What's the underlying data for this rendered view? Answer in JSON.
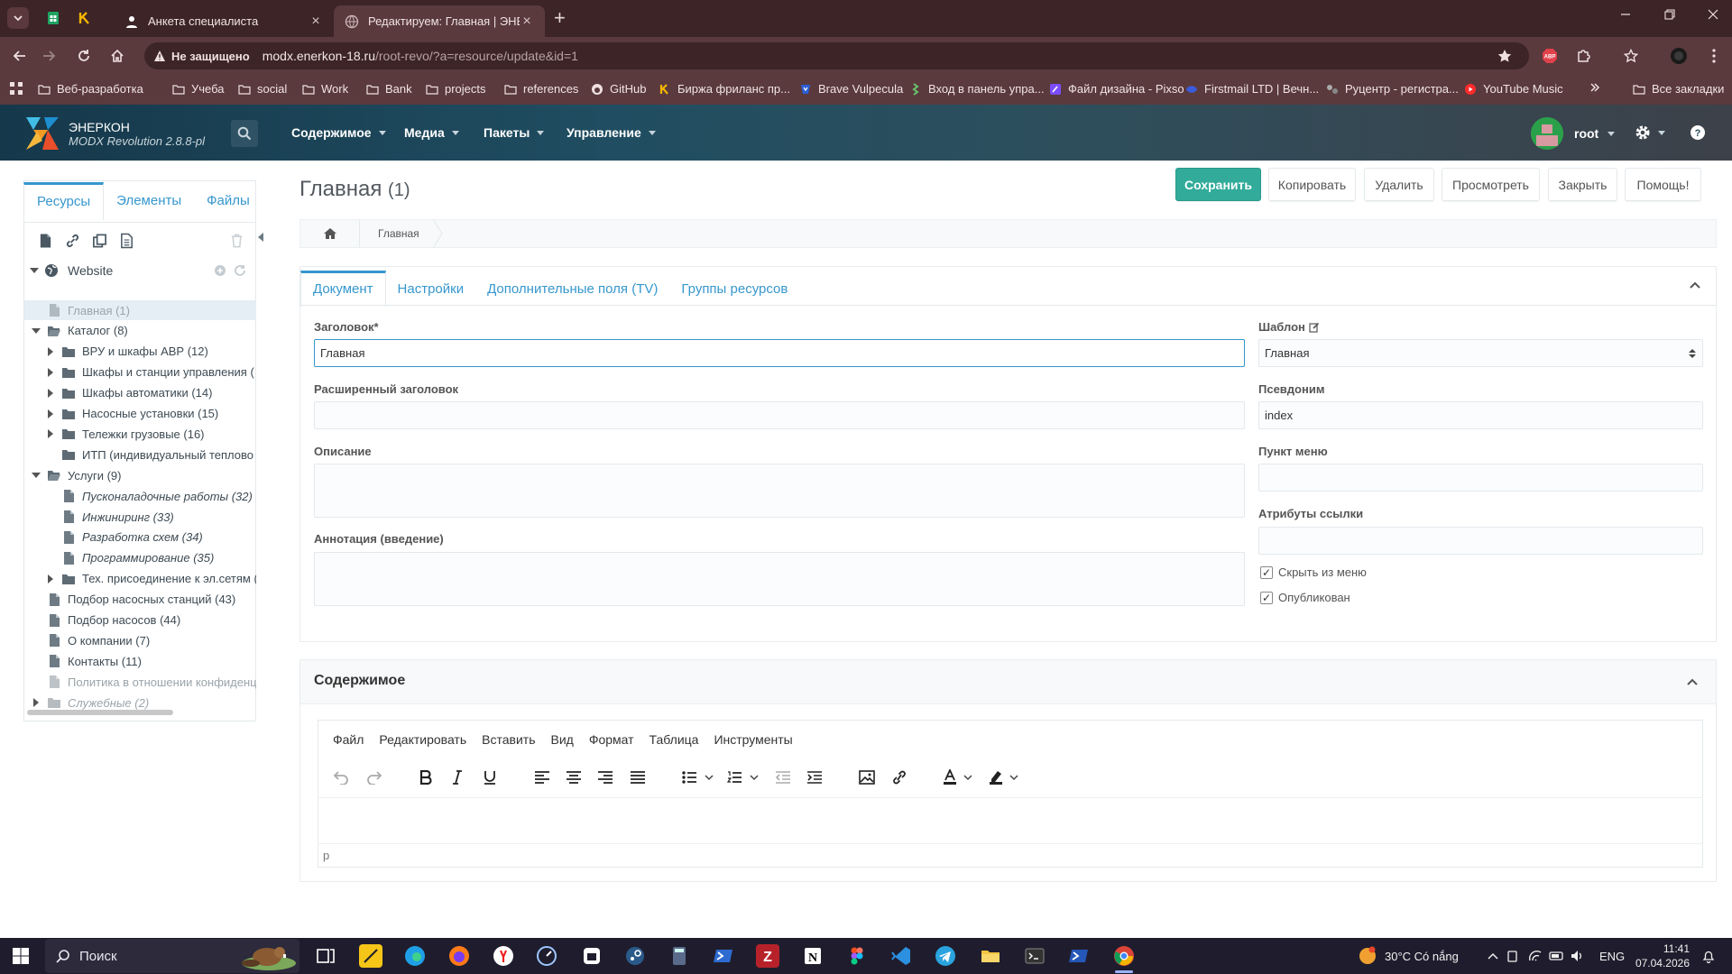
{
  "browser": {
    "tabs": [
      {
        "title": "Анкета специалиста"
      },
      {
        "title": "Редактируем: Главная | ЭНЕРКОН"
      }
    ],
    "address": {
      "security_label": "Не защищено",
      "url_host": "modx.enerkon-18.ru",
      "url_path": "/root-revo/?a=resource/update&id=1"
    },
    "bookmarks": [
      {
        "label": "Веб-разработка",
        "icon": "folder-icon"
      },
      {
        "label": "Учеба",
        "icon": "folder-icon"
      },
      {
        "label": "social",
        "icon": "folder-icon"
      },
      {
        "label": "Work",
        "icon": "folder-icon"
      },
      {
        "label": "Bank",
        "icon": "folder-icon"
      },
      {
        "label": "projects",
        "icon": "folder-icon"
      },
      {
        "label": "references",
        "icon": "folder-icon"
      },
      {
        "label": "GitHub",
        "icon": "github-icon"
      },
      {
        "label": "Биржа фриланс пр...",
        "icon": "kwork-icon"
      },
      {
        "label": "Brave Vulpecula",
        "icon": "brave-icon"
      },
      {
        "label": "Вход в панель упра...",
        "icon": "panel-icon"
      },
      {
        "label": "Файл дизайна - Pixso",
        "icon": "pixso-icon"
      },
      {
        "label": "Firstmail LTD | Вечн...",
        "icon": "firstmail-icon"
      },
      {
        "label": "Руцентр - регистра...",
        "icon": "rucenter-icon"
      },
      {
        "label": "YouTube Music",
        "icon": "youtube-music-icon"
      }
    ],
    "all_bookmarks_label": "Все закладки"
  },
  "modx": {
    "brand_name": "ЭНЕРКОН",
    "brand_version": "MODX Revolution 2.8.8-pl",
    "menu": [
      "Содержимое",
      "Медиа",
      "Пакеты",
      "Управление"
    ],
    "user": "root",
    "header_colors": {
      "start": "#16384b",
      "end": "#3d4149"
    }
  },
  "sidebar": {
    "tabs": [
      "Ресурсы",
      "Элементы",
      "Файлы"
    ],
    "root": "Website",
    "tree": [
      {
        "label": "Главная (1)",
        "depth": 0,
        "expander": "",
        "icon": "page-icon",
        "selected": true
      },
      {
        "label": "Каталог (8)",
        "depth": 0,
        "expander": "open",
        "icon": "folder-open-icon"
      },
      {
        "label": "ВРУ и шкафы АВР (12)",
        "depth": 1,
        "expander": "closed",
        "icon": "folder-icon"
      },
      {
        "label": "Шкафы и станции управления (",
        "depth": 1,
        "expander": "closed",
        "icon": "folder-icon"
      },
      {
        "label": "Шкафы автоматики (14)",
        "depth": 1,
        "expander": "closed",
        "icon": "folder-icon"
      },
      {
        "label": "Насосные установки (15)",
        "depth": 1,
        "expander": "closed",
        "icon": "folder-icon"
      },
      {
        "label": "Тележки грузовые (16)",
        "depth": 1,
        "expander": "closed",
        "icon": "folder-icon"
      },
      {
        "label": "ИТП (индивидуальный теплово",
        "depth": 1,
        "expander": "",
        "icon": "folder-icon"
      },
      {
        "label": "Услуги (9)",
        "depth": 0,
        "expander": "open",
        "icon": "folder-open-icon"
      },
      {
        "label": "Пусконаладочные работы (32)",
        "depth": 1,
        "expander": "",
        "icon": "page-icon",
        "italic": true
      },
      {
        "label": "Инжиниринг (33)",
        "depth": 1,
        "expander": "",
        "icon": "page-icon",
        "italic": true
      },
      {
        "label": "Разработка схем (34)",
        "depth": 1,
        "expander": "",
        "icon": "page-icon",
        "italic": true
      },
      {
        "label": "Программирование (35)",
        "depth": 1,
        "expander": "",
        "icon": "page-icon",
        "italic": true
      },
      {
        "label": "Тех. присоединение к эл.сетям (",
        "depth": 1,
        "expander": "closed",
        "icon": "folder-icon"
      },
      {
        "label": "Подбор насосных станций (43)",
        "depth": 0,
        "expander": "",
        "icon": "page-icon"
      },
      {
        "label": "Подбор насосов (44)",
        "depth": 0,
        "expander": "",
        "icon": "page-icon"
      },
      {
        "label": "О компании (7)",
        "depth": 0,
        "expander": "",
        "icon": "page-icon"
      },
      {
        "label": "Контакты (11)",
        "depth": 0,
        "expander": "",
        "icon": "page-icon"
      },
      {
        "label": "Политика в отношении конфиденц",
        "depth": 0,
        "expander": "",
        "icon": "page-icon",
        "dim": true
      },
      {
        "label": "Служебные (2)",
        "depth": 0,
        "expander": "closed",
        "icon": "folder-icon",
        "italic": true,
        "dim": true
      }
    ]
  },
  "page": {
    "title": "Главная",
    "count": "(1)",
    "buttons": {
      "save": "Сохранить",
      "copy": "Копировать",
      "delete": "Удалить",
      "view": "Просмотреть",
      "close": "Закрыть",
      "help": "Помощь!"
    },
    "breadcrumb": "Главная",
    "tabs": [
      "Документ",
      "Настройки",
      "Дополнительные поля (TV)",
      "Группы ресурсов"
    ],
    "fields": {
      "pagetitle_label": "Заголовок*",
      "pagetitle_value": "Главная",
      "longtitle_label": "Расширенный заголовок",
      "longtitle_value": "",
      "description_label": "Описание",
      "description_value": "",
      "introtext_label": "Аннотация (введение)",
      "introtext_value": "",
      "template_label": "Шаблон",
      "template_value": "Главная",
      "alias_label": "Псевдоним",
      "alias_value": "index",
      "menutitle_label": "Пункт меню",
      "menutitle_value": "",
      "link_attributes_label": "Атрибуты ссылки",
      "link_attributes_value": "",
      "hidemenu_label": "Скрыть из меню",
      "hidemenu_checked": true,
      "published_label": "Опубликован",
      "published_checked": true
    },
    "content_section": {
      "title": "Содержимое",
      "editor_menu": [
        "Файл",
        "Редактировать",
        "Вставить",
        "Вид",
        "Формат",
        "Таблица",
        "Инструменты"
      ],
      "statusbar": "p"
    },
    "accent_color": "#3697cd",
    "save_color": "#32ab9a"
  },
  "taskbar": {
    "search_placeholder": "Поиск",
    "weather": "30°C  Có nắng",
    "lang": "ENG",
    "time": "11:41",
    "date": "07.04.2026"
  }
}
